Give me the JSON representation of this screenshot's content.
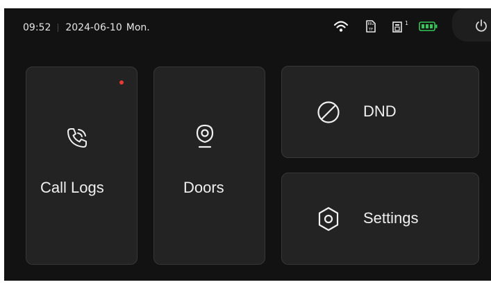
{
  "status_bar": {
    "time": "09:52",
    "date": "2024-06-10",
    "weekday": "Mon.",
    "sd_card_label": "TF",
    "lock_count": "1",
    "battery_color": "#34c759"
  },
  "tiles": {
    "call_logs": {
      "label": "Call Logs",
      "icon": "phone-ring-icon",
      "has_notification": true
    },
    "doors": {
      "label": "Doors",
      "icon": "doorbell-camera-icon"
    },
    "dnd": {
      "label": "DND",
      "icon": "do-not-disturb-icon"
    },
    "settings": {
      "label": "Settings",
      "icon": "hexagon-settings-icon"
    }
  },
  "colors": {
    "background": "#121212",
    "tile": "#232323",
    "tile_border": "#3a3836",
    "notification_dot": "#e53935"
  }
}
